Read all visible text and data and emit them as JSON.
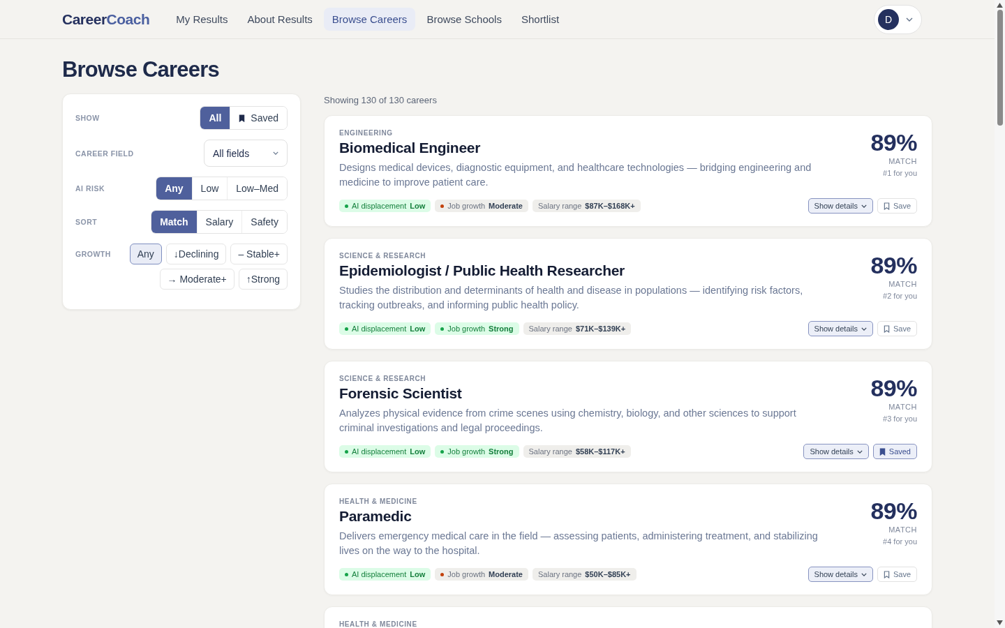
{
  "nav": {
    "logo_first": "Career",
    "logo_second": "Coach",
    "links": [
      {
        "label": "My Results",
        "selected": false
      },
      {
        "label": "About Results",
        "selected": false
      },
      {
        "label": "Browse Careers",
        "selected": true
      },
      {
        "label": "Browse Schools",
        "selected": false
      },
      {
        "label": "Shortlist",
        "selected": false
      }
    ],
    "avatar": "D"
  },
  "title": "Browse Careers",
  "filters": [
    {
      "label": "SHOW",
      "kind": "segmented",
      "options": [
        {
          "label": "All",
          "selected": true,
          "icon": false
        },
        {
          "label": "Saved",
          "selected": false,
          "icon": true
        }
      ]
    },
    {
      "label": "CAREER FIELD",
      "kind": "dropdown",
      "value": "All fields"
    },
    {
      "label": "AI RISK",
      "kind": "segmented",
      "options": [
        {
          "label": "Any",
          "selected": true,
          "icon": false
        },
        {
          "label": "Low",
          "selected": false,
          "icon": false
        },
        {
          "label": "Low–Med",
          "selected": false,
          "icon": false
        }
      ]
    },
    {
      "label": "SORT",
      "kind": "segmented",
      "options": [
        {
          "label": "Match",
          "selected": true,
          "icon": false
        },
        {
          "label": "Salary",
          "selected": false,
          "icon": false
        },
        {
          "label": "Safety",
          "selected": false,
          "icon": false
        }
      ]
    },
    {
      "label": "GROWTH",
      "kind": "chips",
      "options": [
        {
          "label": "Any",
          "selected": true
        },
        {
          "label": "↓Declining",
          "selected": false
        },
        {
          "label": "– Stable+",
          "selected": false
        },
        {
          "label": "→ Moderate+",
          "selected": false
        },
        {
          "label": "↑Strong",
          "selected": false
        }
      ]
    }
  ],
  "result_count": "Showing 130 of 130 careers",
  "careers": [
    {
      "category": "ENGINEERING",
      "name": "Biomedical Engineer",
      "description": "Designs medical devices, diagnostic equipment, and healthcare technologies — bridging engineering and medicine to improve patient care.",
      "match": "89%",
      "match_label": "MATCH",
      "rank": "#1 for you",
      "saved": false,
      "details_label": "Show details",
      "save_label": "Save",
      "tags": [
        {
          "kind": "good",
          "label": "AI displacement",
          "value": "Low",
          "color": "#16a34a"
        },
        {
          "kind": "neutral",
          "label": "Job growth",
          "value": "Moderate",
          "color": "#c2410c"
        },
        {
          "kind": "plain",
          "label": "Salary range",
          "value": "$87K–$168K+"
        }
      ]
    },
    {
      "category": "SCIENCE & RESEARCH",
      "name": "Epidemiologist / Public Health Researcher",
      "description": "Studies the distribution and determinants of health and disease in populations — identifying risk factors, tracking outbreaks, and informing public health policy.",
      "match": "89%",
      "match_label": "MATCH",
      "rank": "#2 for you",
      "saved": false,
      "details_label": "Show details",
      "save_label": "Save",
      "tags": [
        {
          "kind": "good",
          "label": "AI displacement",
          "value": "Low",
          "color": "#16a34a"
        },
        {
          "kind": "good",
          "label": "Job growth",
          "value": "Strong",
          "color": "#16a34a"
        },
        {
          "kind": "plain",
          "label": "Salary range",
          "value": "$71K–$139K+"
        }
      ]
    },
    {
      "category": "SCIENCE & RESEARCH",
      "name": "Forensic Scientist",
      "description": "Analyzes physical evidence from crime scenes using chemistry, biology, and other sciences to support criminal investigations and legal proceedings.",
      "match": "89%",
      "match_label": "MATCH",
      "rank": "#3 for you",
      "saved": true,
      "details_label": "Show details",
      "save_label": "Saved",
      "tags": [
        {
          "kind": "good",
          "label": "AI displacement",
          "value": "Low",
          "color": "#16a34a"
        },
        {
          "kind": "good",
          "label": "Job growth",
          "value": "Strong",
          "color": "#16a34a"
        },
        {
          "kind": "plain",
          "label": "Salary range",
          "value": "$58K–$117K+"
        }
      ]
    },
    {
      "category": "HEALTH & MEDICINE",
      "name": "Paramedic",
      "description": "Delivers emergency medical care in the field — assessing patients, administering treatment, and stabilizing lives on the way to the hospital.",
      "match": "89%",
      "match_label": "MATCH",
      "rank": "#4 for you",
      "saved": false,
      "details_label": "Show details",
      "save_label": "Save",
      "tags": [
        {
          "kind": "good",
          "label": "AI displacement",
          "value": "Low",
          "color": "#16a34a"
        },
        {
          "kind": "neutral",
          "label": "Job growth",
          "value": "Moderate",
          "color": "#c2410c"
        },
        {
          "kind": "plain",
          "label": "Salary range",
          "value": "$50K–$85K+"
        }
      ]
    },
    {
      "category": "HEALTH & MEDICINE"
    }
  ]
}
